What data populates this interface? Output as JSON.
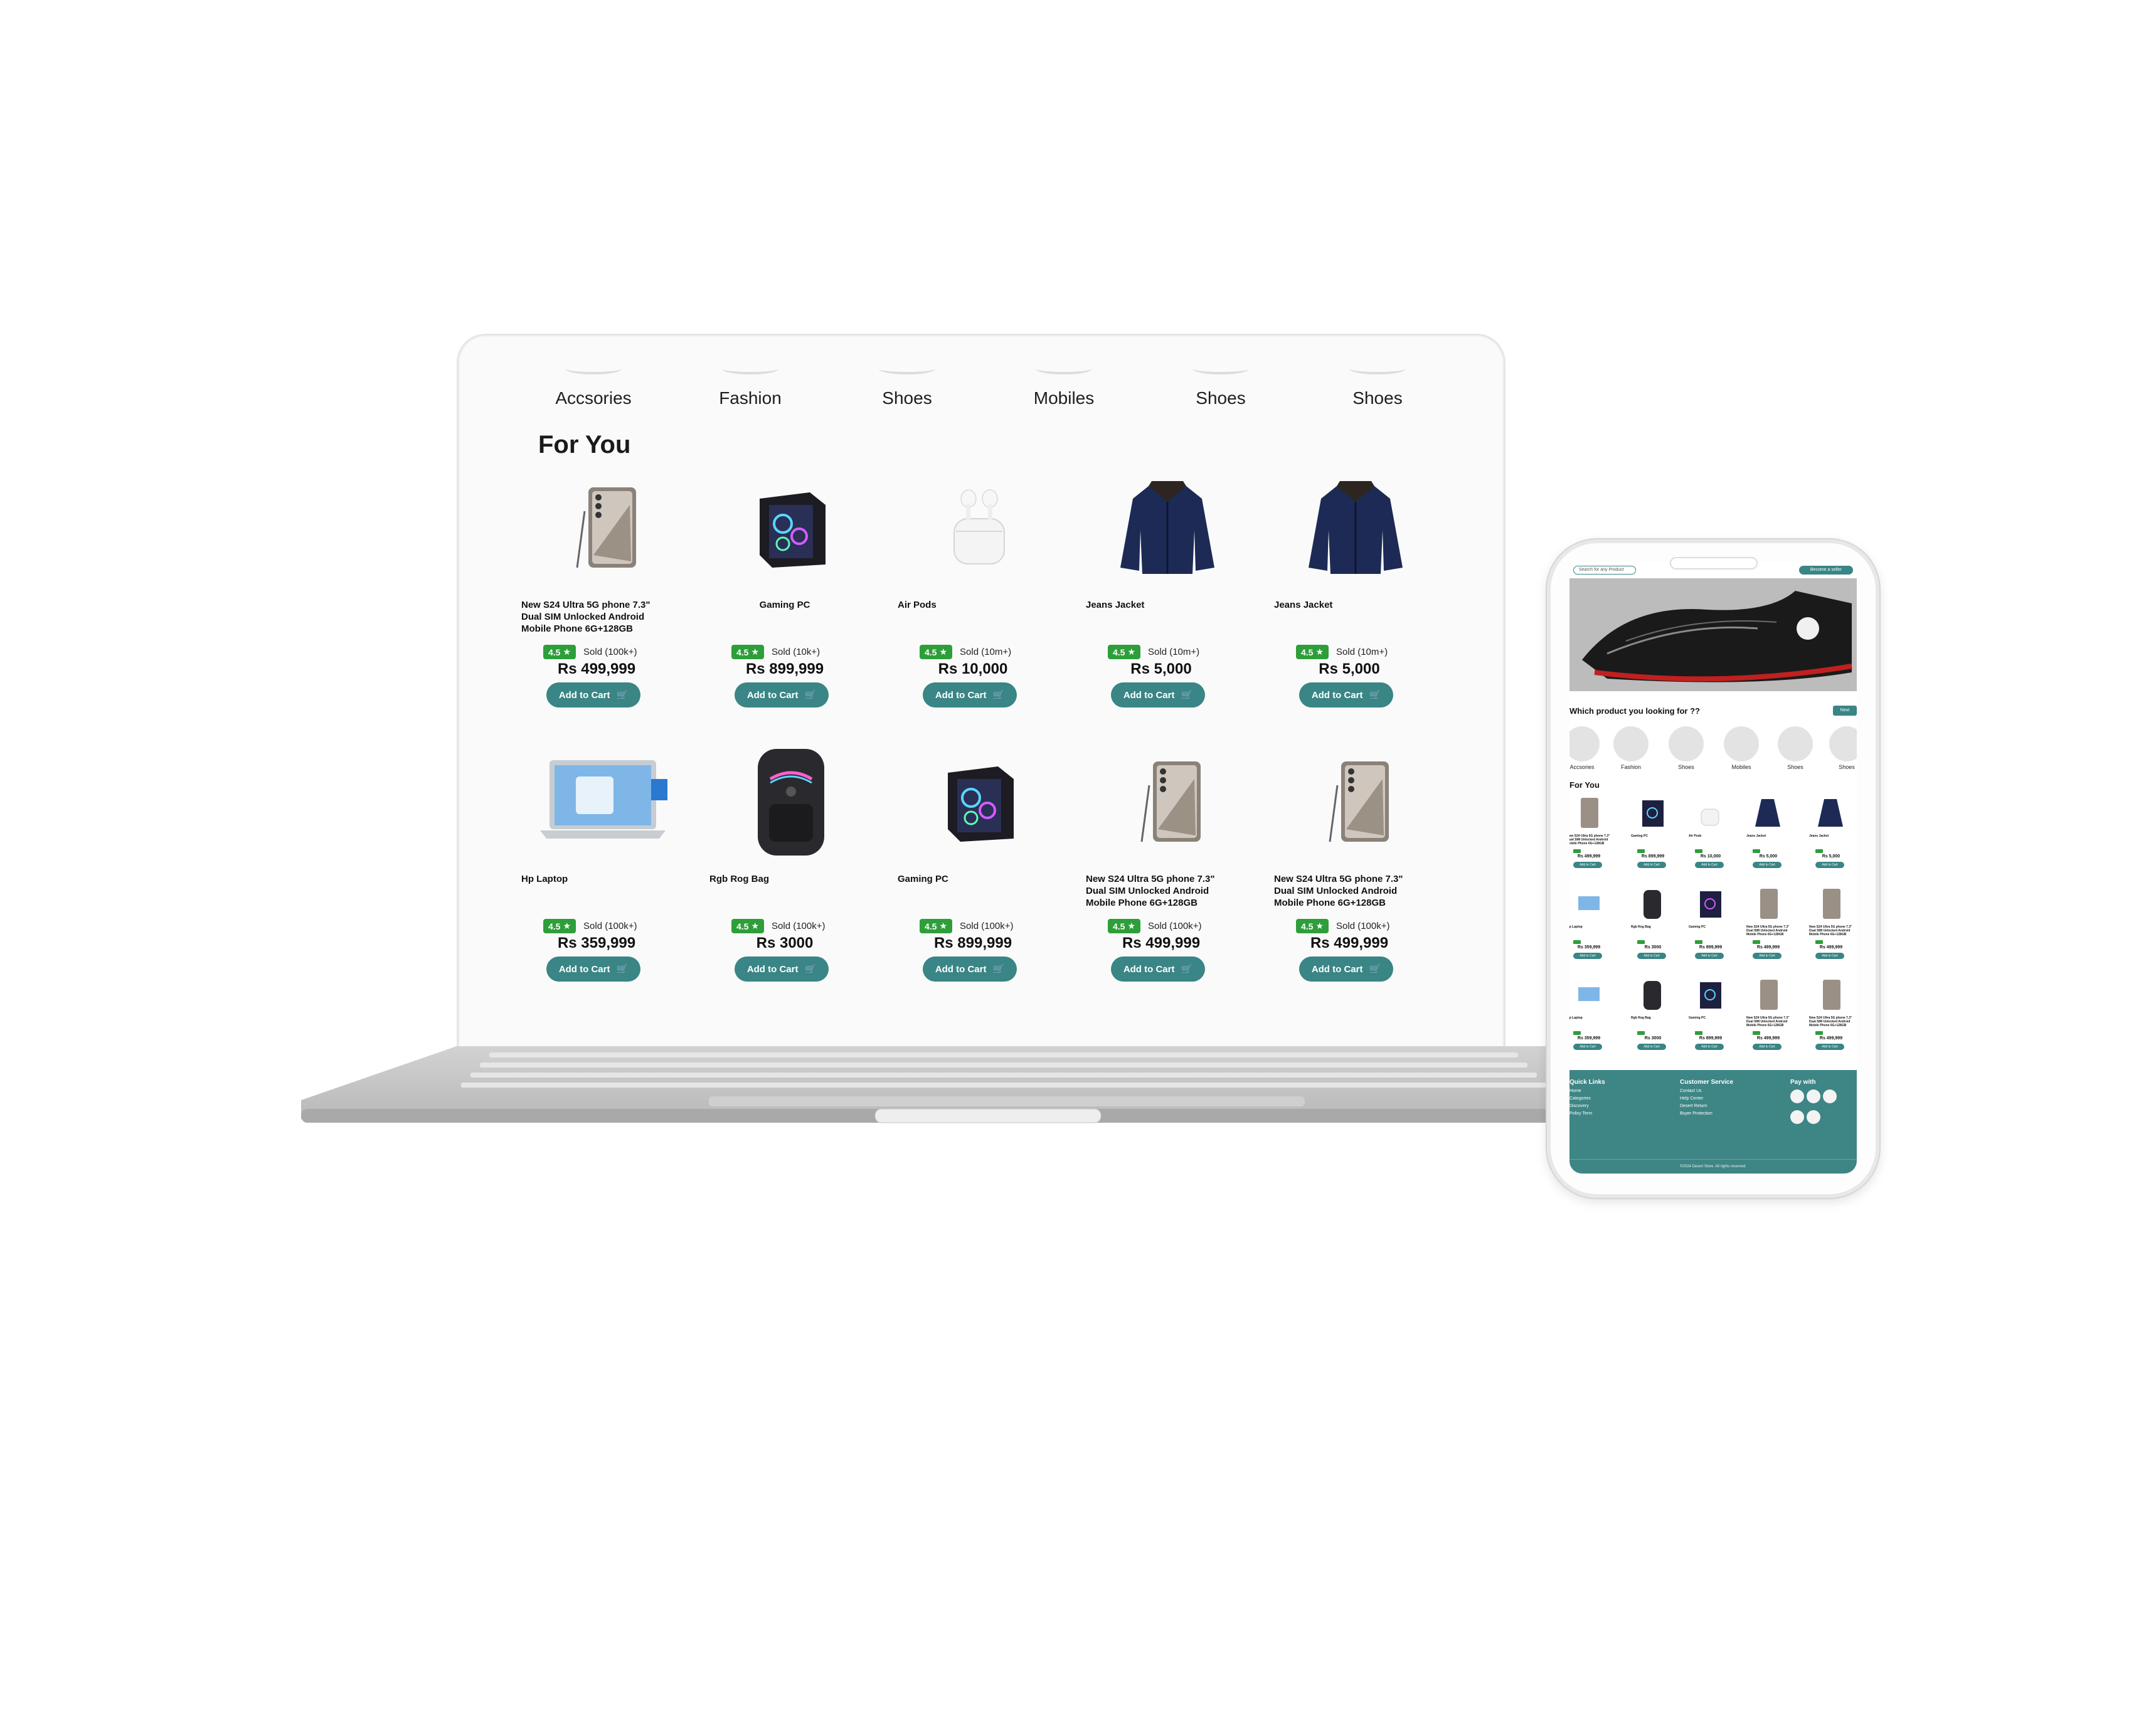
{
  "categories": [
    "Accsories",
    "Fashion",
    "Shoes",
    "Mobiles",
    "Shoes",
    "Shoes"
  ],
  "for_you_title": "For You",
  "add_to_cart_label": "Add to Cart",
  "products": [
    {
      "name": "New S24 Ultra 5G phone 7.3\" Dual SIM Unlocked Android Mobile Phone 6G+128GB",
      "rating": "4.5",
      "sold": "Sold (100k+)",
      "price": "Rs 499,999",
      "icon": "phone-icon"
    },
    {
      "name": "Gaming PC",
      "rating": "4.5",
      "sold": "Sold (10k+)",
      "price": "Rs 899,999",
      "icon": "pc-icon"
    },
    {
      "name": "Air Pods",
      "rating": "4.5",
      "sold": "Sold (10m+)",
      "price": "Rs 10,000",
      "icon": "airpods-icon"
    },
    {
      "name": "Jeans Jacket",
      "rating": "4.5",
      "sold": "Sold (10m+)",
      "price": "Rs 5,000",
      "icon": "jacket-icon"
    },
    {
      "name": "Jeans Jacket",
      "rating": "4.5",
      "sold": "Sold (10m+)",
      "price": "Rs 5,000",
      "icon": "jacket-icon"
    },
    {
      "name": "Hp Laptop",
      "rating": "4.5",
      "sold": "Sold (100k+)",
      "price": "Rs 359,999",
      "icon": "laptop-icon"
    },
    {
      "name": "Rgb Rog Bag",
      "rating": "4.5",
      "sold": "Sold (100k+)",
      "price": "Rs 3000",
      "icon": "bag-icon"
    },
    {
      "name": "Gaming PC",
      "rating": "4.5",
      "sold": "Sold (100k+)",
      "price": "Rs 899,999",
      "icon": "pc-icon"
    },
    {
      "name": "New S24 Ultra 5G phone 7.3\" Dual SIM Unlocked Android Mobile Phone 6G+128GB",
      "rating": "4.5",
      "sold": "Sold (100k+)",
      "price": "Rs 499,999",
      "icon": "phone-icon"
    },
    {
      "name": "New S24 Ultra 5G phone 7.3\" Dual SIM Unlocked Android Mobile Phone 6G+128GB",
      "rating": "4.5",
      "sold": "Sold (100k+)",
      "price": "Rs 499,999",
      "icon": "phone-icon"
    }
  ],
  "phone": {
    "search_placeholder": "Search for any Product",
    "seller_button": "Become a seller",
    "question": "Which product you looking for ??",
    "next_label": "Next",
    "categories": [
      "Accsories",
      "Fashion",
      "Shoes",
      "Mobiles",
      "Shoes",
      "Shoes"
    ],
    "for_you": "For You",
    "footer": {
      "quick_links_title": "Quick Links",
      "quick_links": [
        "Home",
        "Categories",
        "Discovery",
        "Policy Term"
      ],
      "service_title": "Customer Service",
      "service_links": [
        "Contact Us",
        "Help Center",
        "Desert Return",
        "Buyer Protection"
      ],
      "pay_title": "Pay with",
      "copyright": "©2024 Desert Store. All rights reserved."
    }
  },
  "colors": {
    "accent": "#3a8585",
    "rating_green": "#2e9e3a"
  }
}
